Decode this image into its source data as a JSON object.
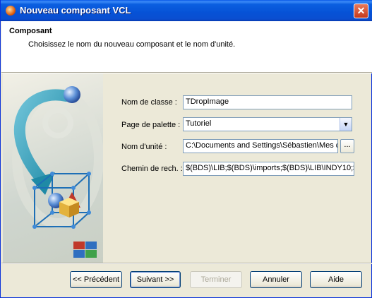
{
  "window": {
    "title": "Nouveau composant VCL",
    "close_glyph": "✕"
  },
  "header": {
    "title": "Composant",
    "description": "Choisissez le nom du nouveau composant et le nom d'unité."
  },
  "form": {
    "class_name": {
      "label": "Nom de classe :",
      "value": "TDropImage"
    },
    "palette_page": {
      "label": "Page de palette :",
      "value": "Tutoriel"
    },
    "unit_name": {
      "label": "Nom d'unité :",
      "value": "C:\\Documents and Settings\\Sébastien\\Mes c",
      "browse": "..."
    },
    "search_path": {
      "label": "Chemin de rech. :",
      "value": "$(BDS)\\LIB;$(BDS)\\imports;$(BDS)\\LIB\\INDY10;$("
    }
  },
  "buttons": {
    "back": "<< Précédent",
    "next": "Suivant >>",
    "finish": "Terminer",
    "cancel": "Annuler",
    "help": "Aide"
  },
  "icons": {
    "app": "delphi-helmet-icon",
    "close": "close-icon",
    "dropdown": "chevron-down-icon",
    "banner": "component-cube-illustration"
  }
}
